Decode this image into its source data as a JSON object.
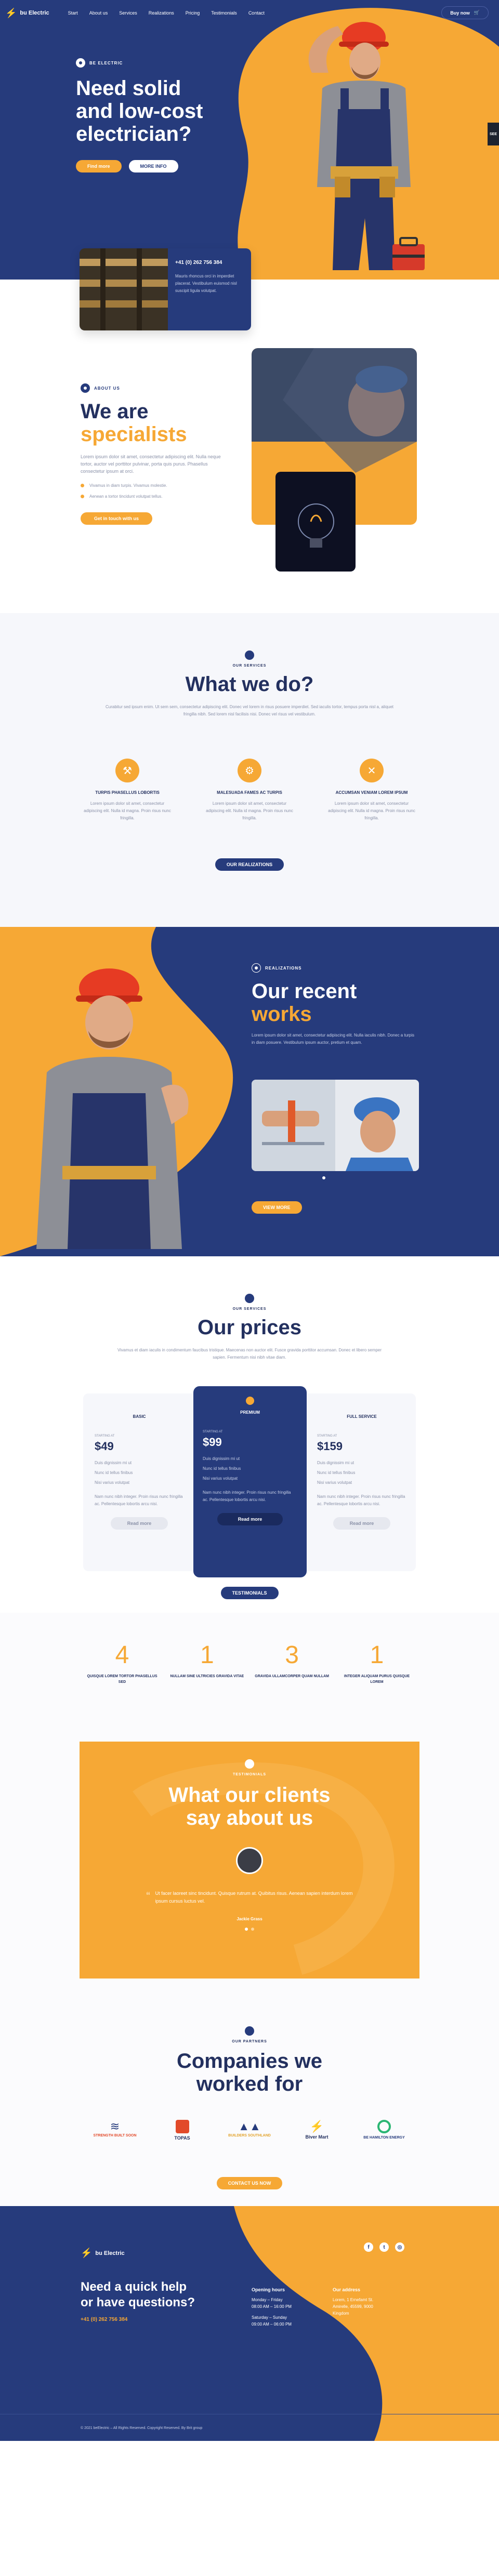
{
  "nav": {
    "logo_text": "bu Electric",
    "items": [
      "Start",
      "About us",
      "Services",
      "Realizations",
      "Pricing",
      "Testimonials",
      "Contact"
    ],
    "cta": "Buy now"
  },
  "hero": {
    "eyebrow": "BE ELECTRIC",
    "title_line1": "Need solid",
    "title_line2": "and low-cost",
    "title_line3": "electrician?",
    "btn_primary": "Find more",
    "btn_secondary": "MORE INFO",
    "side_tab": "SEE"
  },
  "contact_card": {
    "phone": "+41 (0) 262 756 384",
    "text": "Mauris rhoncus orci in imperdiet placerat. Vestibulum euismod nisl suscipit ligula volutpat."
  },
  "about": {
    "eyebrow": "ABOUT US",
    "title1": "We are",
    "title2": "specialists",
    "text": "Lorem ipsum dolor sit amet, consectetur adipiscing elit. Nulla neque tortor, auctor vel porttitor pulvinar, porta quis purus. Phasellus consectetur ipsum at orci.",
    "bullets": [
      "Vivamus in diam turpis. Vivamus molestie.",
      "Aenean a tortor tincidunt volutpat tellus."
    ],
    "button": "Get in touch with us"
  },
  "services": {
    "eyebrow": "OUR SERVICES",
    "title": "What we do?",
    "intro": "Curabitur sed ipsum enim. Ut sem sem, consectetur adipiscing elit. Donec vel lorem in risus posuere imperdiet. Sed iaculis tortor, tempus porta nisl a, aliquet fringilla nibh. Sed lorem nisl facilisis nisi. Donec vel risus vel vestibulum.",
    "items": [
      {
        "title": "TURPIS PHASELLUS LOBORTIS",
        "text": "Lorem ipsum dolor sit amet, consectetur adipiscing elit. Nulla id magna. Proin risus nunc fringilla."
      },
      {
        "title": "MALESUADA FAMES AC TURPIS",
        "text": "Lorem ipsum dolor sit amet, consectetur adipiscing elit. Nulla id magna. Proin risus nunc fringilla."
      },
      {
        "title": "ACCUMSAN VENIAM LOREM IPSUM",
        "text": "Lorem ipsum dolor sit amet, consectetur adipiscing elit. Nulla id magna. Proin risus nunc fringilla."
      }
    ],
    "button": "OUR REALIZATIONS"
  },
  "works": {
    "eyebrow": "REALIZATIONS",
    "title1": "Our recent",
    "title2": "works",
    "text": "Lorem ipsum dolor sit amet, consectetur adipiscing elit. Nulla iaculis nibh. Donec a turpis in diam posuere. Vestibulum ipsum auctor, pretium et quam.",
    "button": "VIEW MORE"
  },
  "prices": {
    "eyebrow": "OUR SERVICES",
    "title": "Our prices",
    "intro": "Vivamus et diam iaculis in condimentum faucibus tristique. Maecenas non auctor elit. Fusce gravida porttitor accumsan. Donec et libero semper sapien. Fermentum nisi nibh vitae diam.",
    "plans": [
      {
        "name": "BASIC",
        "from": "STARTING AT",
        "price": "$49",
        "features": [
          "Duis dignissim mi ut",
          "Nunc id tellus finibus",
          "Nisi varius volutpat"
        ],
        "text": "Nam nunc nibh integer. Proin risus nunc fringilla ac. Pellentesque lobortis arcu nisi.",
        "button": "Read more"
      },
      {
        "name": "PREMIUM",
        "from": "STARTING AT",
        "price": "$99",
        "features": [
          "Duis dignissim mi ut",
          "Nunc id tellus finibus",
          "Nisi varius volutpat"
        ],
        "text": "Nam nunc nibh integer. Proin risus nunc fringilla ac. Pellentesque lobortis arcu nisi.",
        "button": "Read more"
      },
      {
        "name": "FULL SERVICE",
        "from": "STARTING AT",
        "price": "$159",
        "features": [
          "Duis dignissim mi ut",
          "Nunc id tellus finibus",
          "Nisi varius volutpat"
        ],
        "text": "Nam nunc nibh integer. Proin risus nunc fringilla ac. Pellentesque lobortis arcu nisi.",
        "button": "Read more"
      }
    ],
    "button": "TESTIMONIALS"
  },
  "stats": [
    {
      "value": "4",
      "label": "QUISQUE LOREM TORTOR PHASELLUS SED"
    },
    {
      "value": "1",
      "label": "NULLAM SINE ULTRICIES GRAVIDA VITAE"
    },
    {
      "value": "3",
      "label": "GRAVIDA ULLAMCORPER QUAM NULLAM"
    },
    {
      "value": "1",
      "label": "INTEGER ALIQUAM PURUS QUISQUE LOREM"
    }
  ],
  "testimonial": {
    "eyebrow": "TESTIMONIALS",
    "title1": "What our clients",
    "title2": "say about us",
    "quote": "Ut facer laoreet sinc tincidunt. Quisque rutrum at. Quibitus risus. Aenean sapien interdum lorem ipsum cursus luctus vel.",
    "author": "Jackie Grass"
  },
  "partners": {
    "eyebrow": "OUR PARTNERS",
    "title1": "Companies we",
    "title2": "worked for",
    "logos": [
      "STRENGTH BUILT SOON",
      "TOPAS",
      "BUILDERS SOUTHLAND",
      "Biver Mart",
      "BE HAMILTON ENERGY"
    ],
    "button": "CONTACT US NOW"
  },
  "footer": {
    "logo_text": "bu Electric",
    "heading1": "Need a quick help",
    "heading2": "or have questions?",
    "phone": "+41 (0) 262 756 384",
    "hours_title": "Opening hours",
    "hours": [
      "Monday – Friday",
      "08:00 AM – 16:00 PM",
      "Saturday – Sunday",
      "09:00 AM – 06:00 PM"
    ],
    "address_title": "Our address",
    "address": [
      "Lorem, 1 Ernefamt St.",
      "Amirelle, 45599, 9000",
      "Kingdom"
    ],
    "copyright": "© 2021 beElectric – All Rights Reserved. Copyright Reserved. By Brit group"
  }
}
